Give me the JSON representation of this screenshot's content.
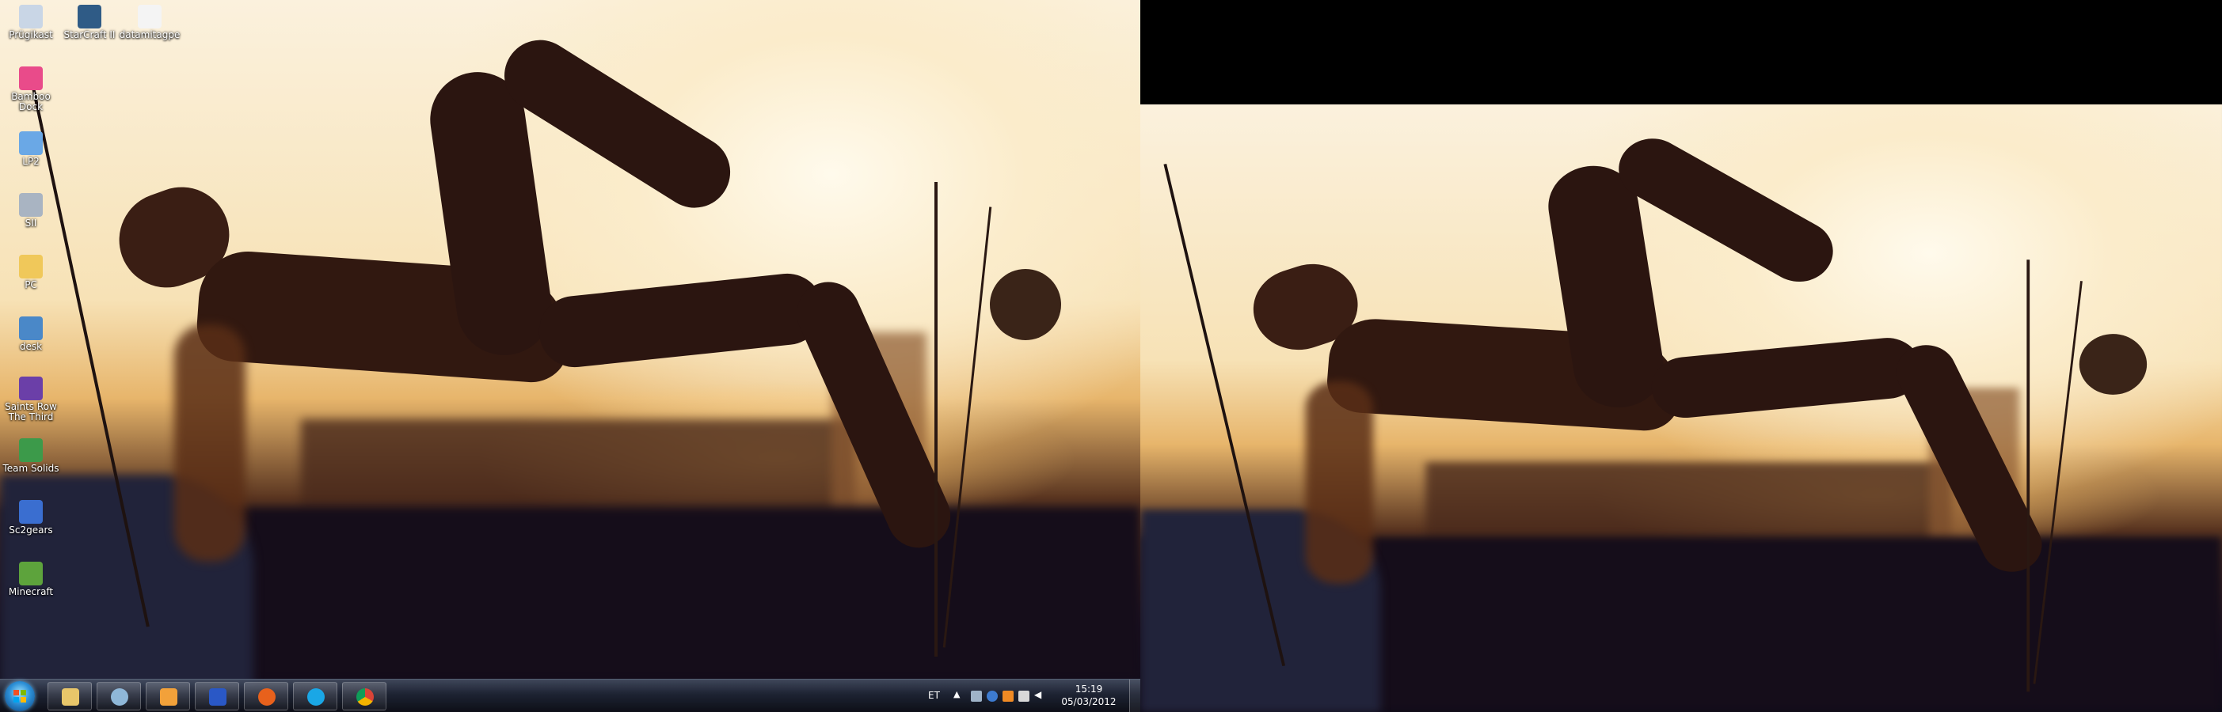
{
  "desktop": {
    "icons": [
      {
        "label": "Prügikast",
        "icon": "recycle-bin-icon",
        "color": "#c9d6e6"
      },
      {
        "label": "StarCraft II",
        "icon": "starcraft-icon",
        "color": "#2f5b86"
      },
      {
        "label": "datamitagpe",
        "icon": "text-file-icon",
        "color": "#f4f4f4"
      },
      {
        "label": "Bamboo Dock",
        "icon": "bamboo-dock-icon",
        "color": "#e94b8a"
      },
      {
        "label": "LP2",
        "icon": "lp2-icon",
        "color": "#6aa8e6"
      },
      {
        "label": "SII",
        "icon": "sii-icon",
        "color": "#a9b4c2"
      },
      {
        "label": "PC",
        "icon": "folder-icon",
        "color": "#f0c85a"
      },
      {
        "label": "desk",
        "icon": "desk-shortcut-icon",
        "color": "#4a88c8"
      },
      {
        "label": "Saints Row The Third",
        "icon": "saints-row-icon",
        "color": "#6b3fa8"
      },
      {
        "label": "Team Solids",
        "icon": "team-solids-icon",
        "color": "#3c9a4a"
      },
      {
        "label": "Sc2gears",
        "icon": "sc2gears-icon",
        "color": "#3a6ed0"
      },
      {
        "label": "Minecraft",
        "icon": "minecraft-icon",
        "color": "#5da33c"
      }
    ]
  },
  "taskbar": {
    "pinned": [
      {
        "name": "explorer",
        "icon": "file-explorer-icon",
        "color": "#e8c66a"
      },
      {
        "name": "network",
        "icon": "network-icon",
        "color": "#8fb7d8"
      },
      {
        "name": "stickies",
        "icon": "stickies-icon",
        "color": "#f2a13a"
      },
      {
        "name": "media",
        "icon": "media-center-icon",
        "color": "#2a58c6"
      },
      {
        "name": "firefox",
        "icon": "firefox-icon",
        "color": "#e8611c"
      },
      {
        "name": "skype",
        "icon": "skype-icon",
        "color": "#1aa7e6"
      },
      {
        "name": "chrome",
        "icon": "chrome-icon",
        "color": "#3b9a3e"
      }
    ],
    "language": "ET",
    "clock": {
      "time": "15:19",
      "date": "05/03/2012"
    },
    "tray_icons": [
      "chevron-up-icon",
      "usb-icon",
      "network-tray-icon",
      "avast-icon",
      "wifi-icon",
      "speaker-icon",
      "flag-icon"
    ]
  }
}
